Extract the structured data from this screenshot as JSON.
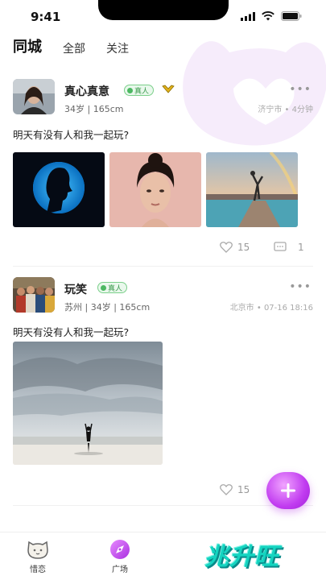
{
  "status_bar": {
    "time": "9:41"
  },
  "tabs": [
    {
      "label": "同城",
      "active": true
    },
    {
      "label": "全部",
      "active": false
    },
    {
      "label": "关注",
      "active": false
    }
  ],
  "posts": [
    {
      "username": "真心真意",
      "badge": "真人",
      "vip": true,
      "meta": "34岁 | 165cm",
      "location_time": "济宁市 • 4分钟",
      "more": "•••",
      "text": "明天有没有人和我一起玩?",
      "photos": [
        "silhouette-profile",
        "woman-portrait",
        "pier-dancer"
      ],
      "likes": "15",
      "comments": "1"
    },
    {
      "username": "玩笑",
      "badge": "真人",
      "vip": false,
      "meta": "苏州 | 34岁 | 165cm",
      "location_time": "北京市 • 07-16  18:16",
      "more": "•••",
      "text": "明天有没有人和我一起玩?",
      "photos": [
        "beach-person"
      ],
      "likes": "15"
    }
  ],
  "bottom_nav": [
    {
      "label": "惜恋",
      "icon": "cat-face-icon"
    },
    {
      "label": "广场",
      "icon": "compass-icon"
    }
  ],
  "watermark": "兆升旺",
  "colors": {
    "accent": "#c13cf0",
    "badge_green": "#4cb862",
    "watermark": "#14d4c0"
  }
}
